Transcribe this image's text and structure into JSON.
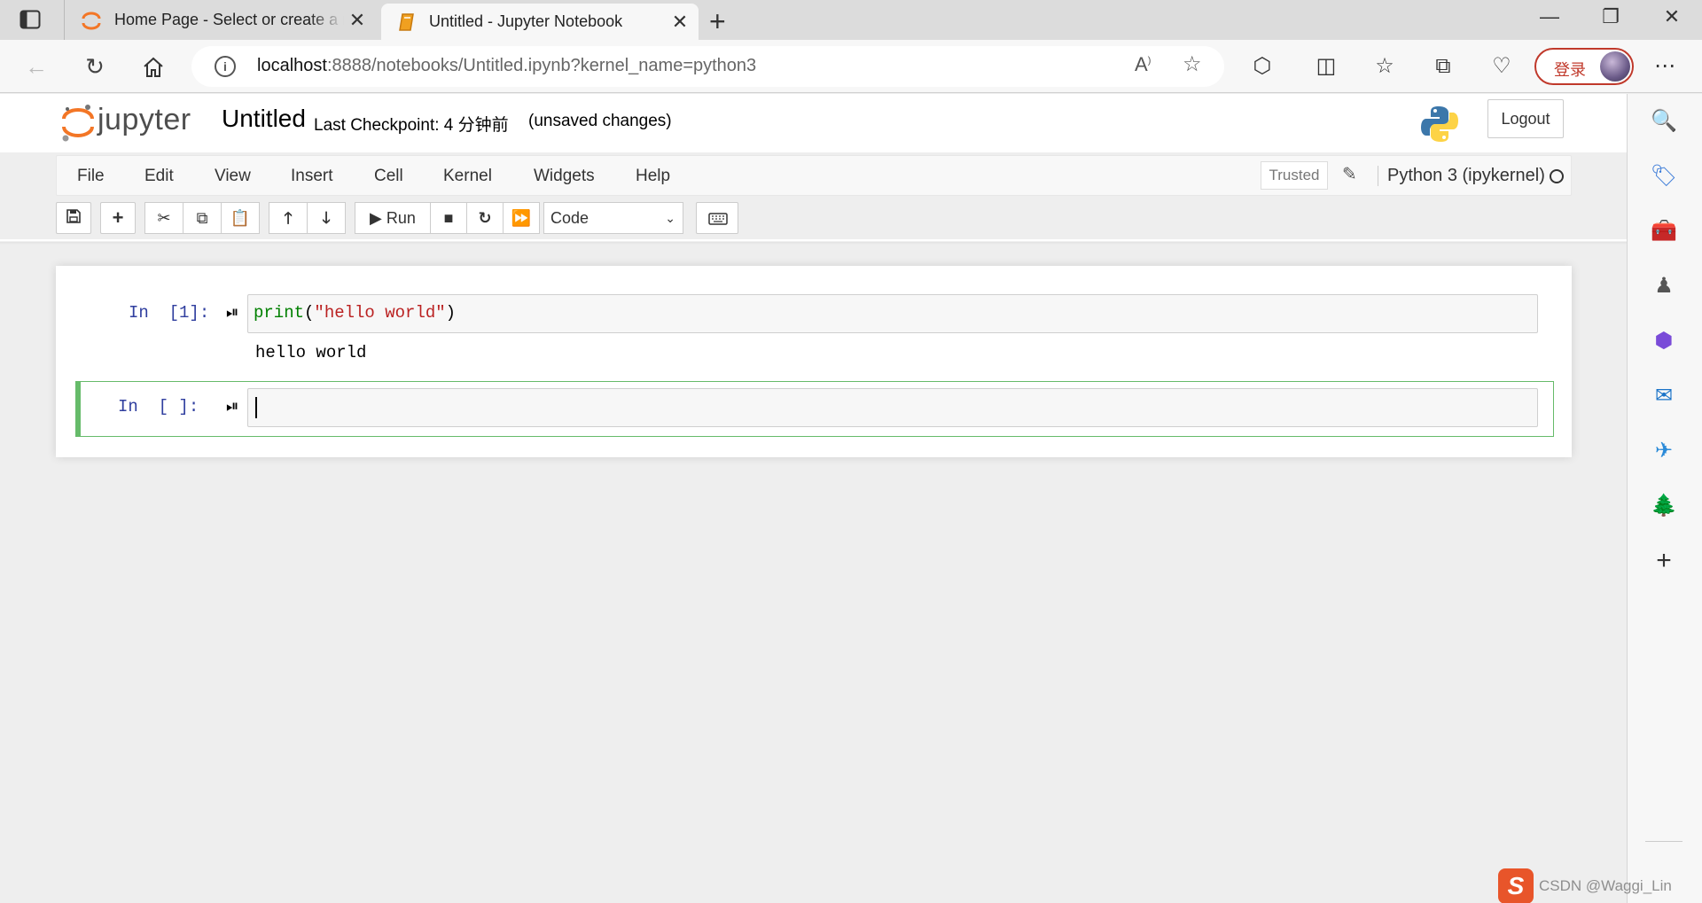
{
  "browser": {
    "tabs": [
      {
        "title": "Home Page - Select or create a notebook",
        "active": false,
        "icon": "jupyter-orbit-icon"
      },
      {
        "title": "Untitled - Jupyter Notebook",
        "active": true,
        "icon": "notebook-book-icon"
      }
    ],
    "address": {
      "host": "localhost",
      "rest": ":8888/notebooks/Untitled.ipynb?kernel_name=python3"
    },
    "login_label": "登录"
  },
  "jupyter": {
    "logo_text": "jupyter",
    "notebook_title": "Untitled",
    "checkpoint": "Last Checkpoint: 4 分钟前",
    "unsaved": "(unsaved changes)",
    "logout_label": "Logout",
    "menus": [
      "File",
      "Edit",
      "View",
      "Insert",
      "Cell",
      "Kernel",
      "Widgets",
      "Help"
    ],
    "trusted_label": "Trusted",
    "kernel_name": "Python 3 (ipykernel)",
    "run_label": "Run",
    "cell_type": "Code",
    "colors": {
      "selected_border": "#66bb6a",
      "prompt": "#303f9f",
      "logo_orange": "#f37626"
    }
  },
  "cells": [
    {
      "prompt": "In  [1]:",
      "code_fn": "print",
      "code_open": "(",
      "code_str": "\"hello world\"",
      "code_close": ")",
      "output": "hello world"
    },
    {
      "prompt": "In  [ ]:",
      "code": ""
    }
  ],
  "watermark": "CSDN @Waggi_Lin"
}
